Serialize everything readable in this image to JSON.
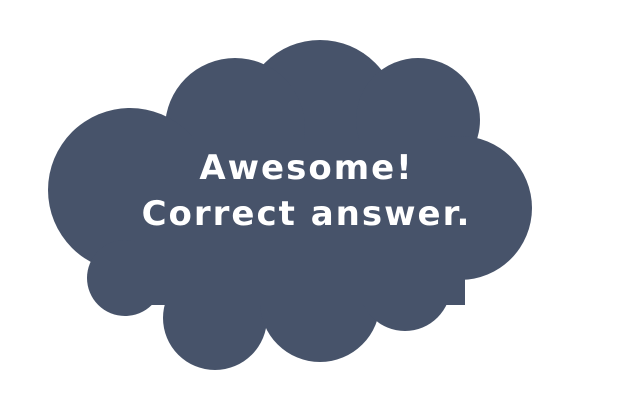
{
  "feedback": {
    "line1": "Awesome!",
    "line2": "Correct answer."
  },
  "colors": {
    "cloud_fill": "#47536a",
    "text": "#ffffff",
    "background": "#ffffff"
  }
}
